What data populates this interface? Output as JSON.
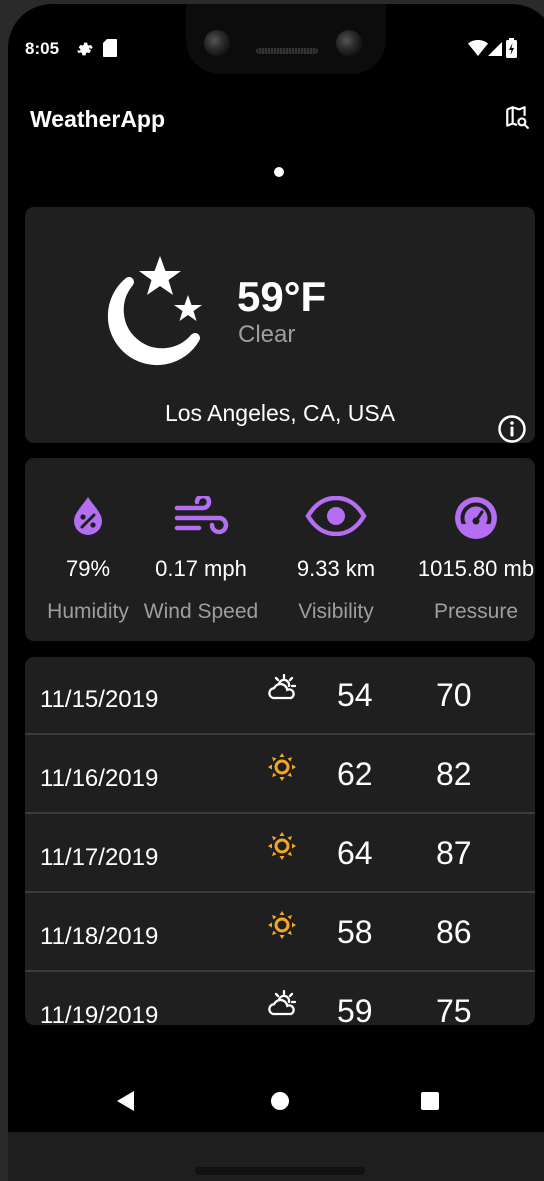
{
  "status_bar": {
    "time": "8:05",
    "icons": [
      "gear-icon",
      "sd-card-icon",
      "wifi-icon",
      "signal-icon",
      "battery-icon"
    ]
  },
  "app_bar": {
    "title": "WeatherApp",
    "action_icon": "map-search-icon"
  },
  "pager": {
    "dots": 1,
    "active_index": 0
  },
  "current": {
    "temperature": "59°F",
    "condition": "Clear",
    "location": "Los Angeles, CA, USA",
    "icon": "moon-stars-icon"
  },
  "details": [
    {
      "icon": "humidity-icon",
      "value": "79%",
      "label": "Humidity"
    },
    {
      "icon": "wind-icon",
      "value": "0.17 mph",
      "label": "Wind Speed"
    },
    {
      "icon": "eye-icon",
      "value": "9.33 km",
      "label": "Visibility"
    },
    {
      "icon": "gauge-icon",
      "value": "1015.80 mb",
      "label": "Pressure"
    }
  ],
  "forecast": [
    {
      "date": "11/15/2019",
      "icon": "partly-cloudy-icon",
      "low": "54",
      "high": "70"
    },
    {
      "date": "11/16/2019",
      "icon": "sun-icon",
      "low": "62",
      "high": "82"
    },
    {
      "date": "11/17/2019",
      "icon": "sun-icon",
      "low": "64",
      "high": "87"
    },
    {
      "date": "11/18/2019",
      "icon": "sun-icon",
      "low": "58",
      "high": "86"
    },
    {
      "date": "11/19/2019",
      "icon": "partly-cloudy-icon",
      "low": "59",
      "high": "75"
    }
  ],
  "colors": {
    "background": "#000000",
    "card": "#1f1f1f",
    "accent_purple": "#b36ef2",
    "sun_orange": "#f5a623",
    "secondary_text": "#9e9e9e"
  },
  "nav_bar": {
    "icons": [
      "back-icon",
      "home-icon",
      "recents-icon"
    ]
  }
}
